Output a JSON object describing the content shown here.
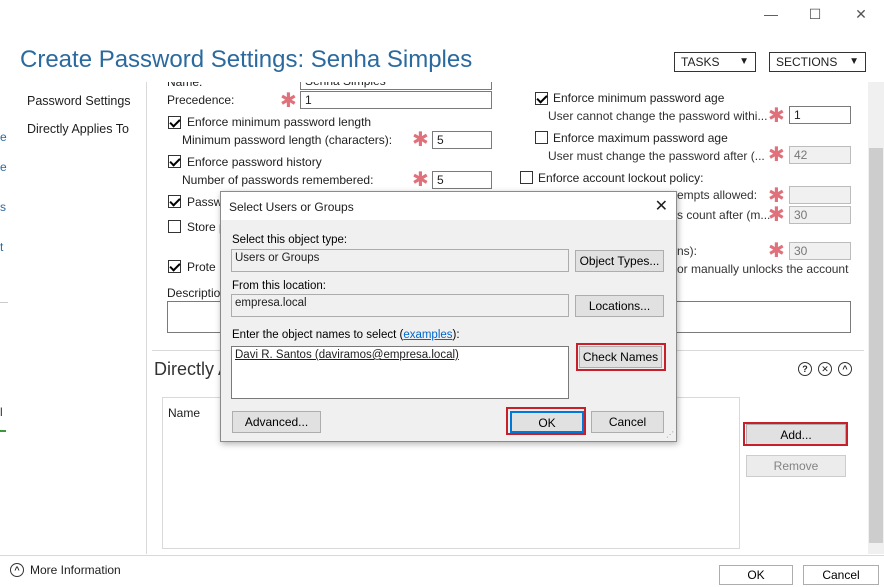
{
  "window": {
    "minimize": "—",
    "maximize": "☐",
    "close": "✕"
  },
  "header": {
    "title": "Create Password Settings: Senha Simples",
    "tasks_label": "TASKS",
    "sections_label": "SECTIONS"
  },
  "nav": {
    "items": [
      "Password Settings",
      "Directly Applies To"
    ]
  },
  "left_edge": [
    "e",
    "s",
    "t",
    "l"
  ],
  "form": {
    "name_label": "Name:",
    "name_value": "Senha Simples",
    "precedence_label": "Precedence:",
    "precedence_value": "1",
    "enforce_min_length_label": "Enforce minimum password length",
    "min_length_label": "Minimum password length (characters):",
    "min_length_value": "5",
    "enforce_history_label": "Enforce password history",
    "history_count_label": "Number of passwords remembered:",
    "history_count_value": "5",
    "complexity_label_partial": "Passw",
    "store_label_partial": "Store p",
    "protect_label_partial": "Prote",
    "description_label_partial": "Descriptio",
    "enforce_min_age_label": "Enforce minimum password age",
    "min_age_label": "User cannot change the password withi...",
    "min_age_value": "1",
    "enforce_max_age_label": "Enforce maximum password age",
    "max_age_label": "User must change the password after (...",
    "max_age_value": "42",
    "lockout_label": "Enforce account lockout policy:",
    "attempts_label_partial": "empts allowed:",
    "reset_label_partial": "s count after (m...",
    "reset_value": "30",
    "duration_label_partial": "ns):",
    "duration_value": "30",
    "manual_unlock_partial": "or manually unlocks the account"
  },
  "applies": {
    "title_partial": "Directly A",
    "name_header": "Name",
    "add_button": "Add...",
    "remove_button": "Remove"
  },
  "dialog": {
    "title": "Select Users or Groups",
    "object_type_label": "Select this object type:",
    "object_type_value": "Users or Groups",
    "object_types_button": "Object Types...",
    "location_label": "From this location:",
    "location_value": "empresa.local",
    "locations_button": "Locations...",
    "names_label_prefix": "Enter the object names to select (",
    "names_label_link": "examples",
    "names_label_suffix": "):",
    "names_value": "Davi R. Santos (daviramos@empresa.local)",
    "check_names_button": "Check Names",
    "advanced_button": "Advanced...",
    "ok_button": "OK",
    "cancel_button": "Cancel"
  },
  "footer": {
    "more_info": "More Information",
    "ok_button": "OK",
    "cancel_button": "Cancel"
  },
  "colors": {
    "title_blue": "#2b6a9e",
    "required_star": "#e0707a",
    "highlight_red": "#c8202a",
    "link_blue": "#0066cc"
  }
}
